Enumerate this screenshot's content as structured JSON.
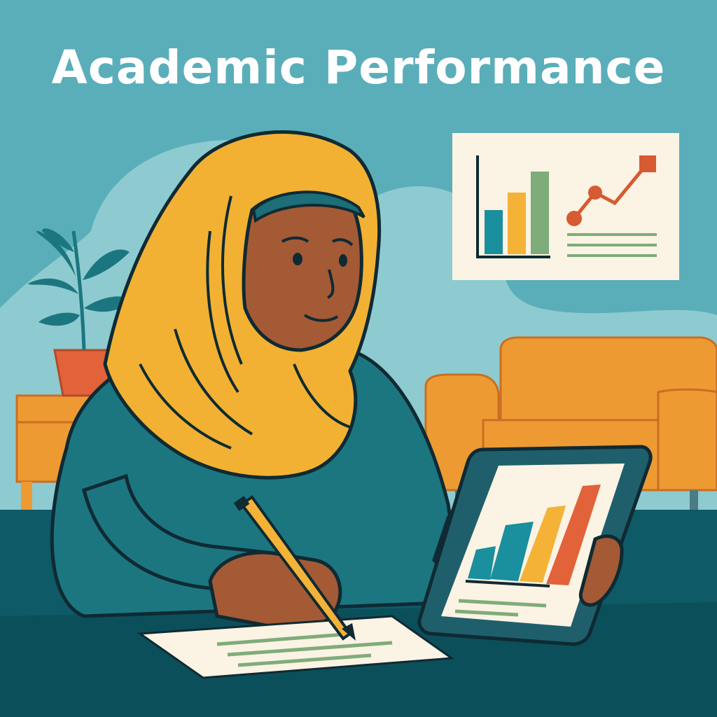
{
  "title": "Academic Performance",
  "colors": {
    "background": "#5aaeb9",
    "background_blob": "#8ecbd0",
    "floor": "#0e5a66",
    "desk": "#0b4f5a",
    "hijab": "#f2b133",
    "hijab_band": "#1c6e78",
    "skin": "#a45a35",
    "shirt": "#1c7680",
    "sofa": "#ee9a33",
    "paper": "#fbf3e3",
    "bar_teal": "#1a8f9e",
    "bar_yellow": "#f4b237",
    "bar_green": "#7fac7b",
    "bar_orange": "#e2623a",
    "line_orange": "#d65a32",
    "pencil": "#f4b237",
    "outline": "#0f2a33"
  },
  "icons": {
    "plant": "potted-plant-icon",
    "wall_chart": "wall-chart-poster",
    "tablet_chart": "tablet-bar-chart",
    "pencil": "pencil-icon"
  }
}
